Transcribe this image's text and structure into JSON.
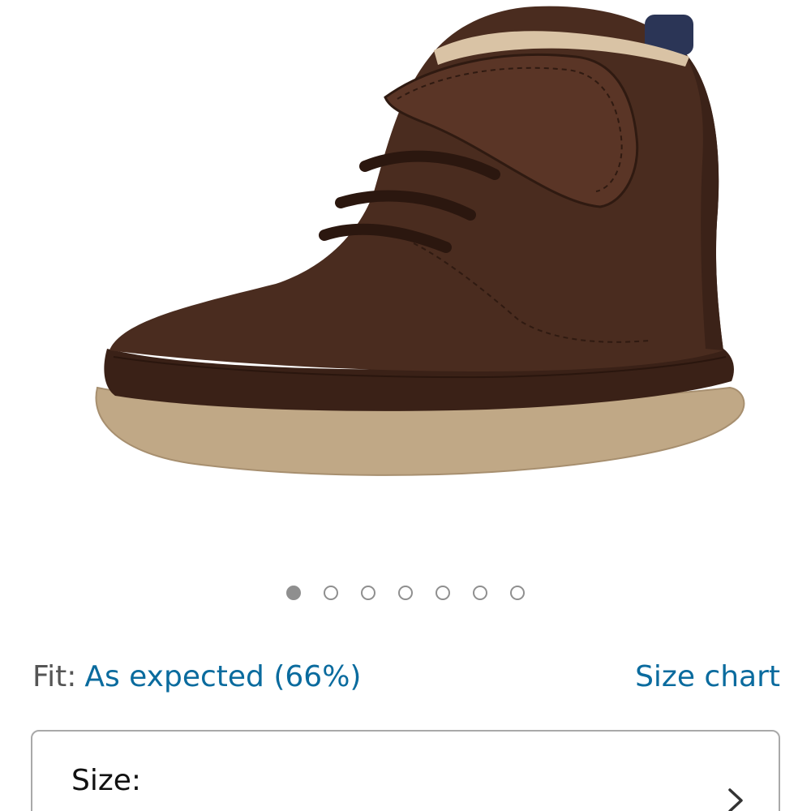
{
  "product": {
    "image_alt": "Brown leather baby boot with strap and laces"
  },
  "carousel": {
    "total_dots": 7,
    "active_index": 0
  },
  "fit": {
    "label": "Fit:",
    "value": "As expected (66%)",
    "size_chart_link": "Size chart"
  },
  "size_selector": {
    "label": "Size:",
    "icon": "chevron-right-icon"
  },
  "colors": {
    "link": "#0a6b9e",
    "dot": "#8f8f8f",
    "border": "#a9a9a9",
    "leather": "#4a2c1f",
    "sole": "#c0a886"
  }
}
